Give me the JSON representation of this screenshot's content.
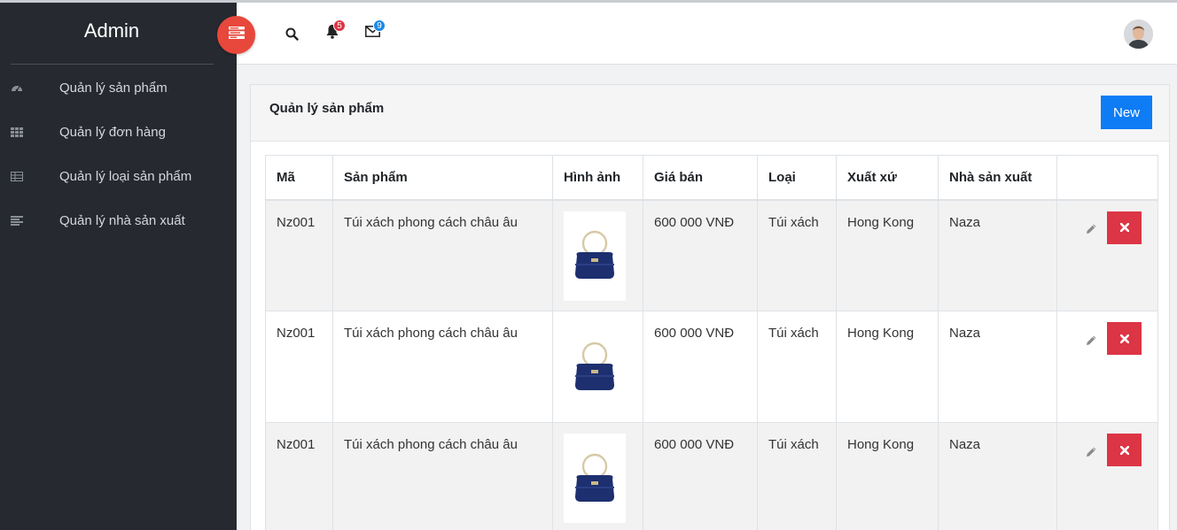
{
  "app": {
    "brand": "Admin"
  },
  "sidebar": {
    "items": [
      {
        "label": "Quản lý sản phẩm",
        "icon": "dashboard-icon"
      },
      {
        "label": "Quản lý đơn hàng",
        "icon": "grid-icon"
      },
      {
        "label": "Quản lý loại sản phẩm",
        "icon": "table-icon"
      },
      {
        "label": "Quản lý nhà sản xuất",
        "icon": "list-icon"
      }
    ]
  },
  "topbar": {
    "notifications": {
      "icon": "bell-icon",
      "count": "5",
      "color": "#dc3545"
    },
    "messages": {
      "icon": "envelope-icon",
      "count": "9",
      "color": "#1a88e8"
    }
  },
  "card": {
    "title": "Quản lý sản phẩm",
    "new_label": "New"
  },
  "table": {
    "headers": [
      "Mã",
      "Sản phẩm",
      "Hình ảnh",
      "Giá bán",
      "Loại",
      "Xuất xứ",
      "Nhà sản xuất",
      ""
    ],
    "rows": [
      {
        "code": "Nz001",
        "name": "Túi xách phong cách châu âu",
        "price": "600 000 VNĐ",
        "type": "Túi xách",
        "origin": "Hong Kong",
        "maker": "Naza"
      },
      {
        "code": "Nz001",
        "name": "Túi xách phong cách châu âu",
        "price": "600 000 VNĐ",
        "type": "Túi xách",
        "origin": "Hong Kong",
        "maker": "Naza"
      },
      {
        "code": "Nz001",
        "name": "Túi xách phong cách châu âu",
        "price": "600 000 VNĐ",
        "type": "Túi xách",
        "origin": "Hong Kong",
        "maker": "Naza"
      }
    ]
  },
  "colors": {
    "sidebar_bg": "#262a30",
    "accent_red": "#e8473c",
    "primary": "#0d7cf5",
    "danger": "#dc3545"
  }
}
